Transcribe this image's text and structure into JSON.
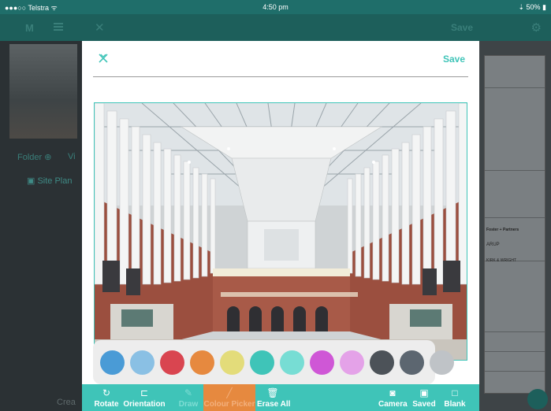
{
  "status_bar": {
    "carrier": "●●●○○ Telstra ᯤ",
    "time": "4:50 pm",
    "battery": "⇣ 50% ▮"
  },
  "background": {
    "folder_label": "Folder",
    "view_label": "Vi",
    "site_plan_label": "Site Plan",
    "create_label": "Crea",
    "outer_save_label": "Save"
  },
  "dialog": {
    "save_label": "Save"
  },
  "palette": {
    "colors": [
      "#4a9bd6",
      "#8ac0e4",
      "#d94550",
      "#e6893f",
      "#e3dc7a",
      "#3fc4b8",
      "#77ddd4",
      "#cf57d6",
      "#e4a2e8",
      "#4c5258",
      "#5c6670",
      "#bfc3c7"
    ]
  },
  "toolbar": {
    "rotate": "Rotate",
    "orientation": "Orientation",
    "draw": "Draw",
    "colour_picker": "Colour Picker",
    "erase_all": "Erase All",
    "camera": "Camera",
    "saved": "Saved",
    "blank": "Blank"
  },
  "drawing_sheet": {
    "firm1": "Foster + Partners",
    "firm2": "ARUP",
    "firm3": "KIRK & WRIGHT"
  },
  "accent_color": "#3fc4b8"
}
